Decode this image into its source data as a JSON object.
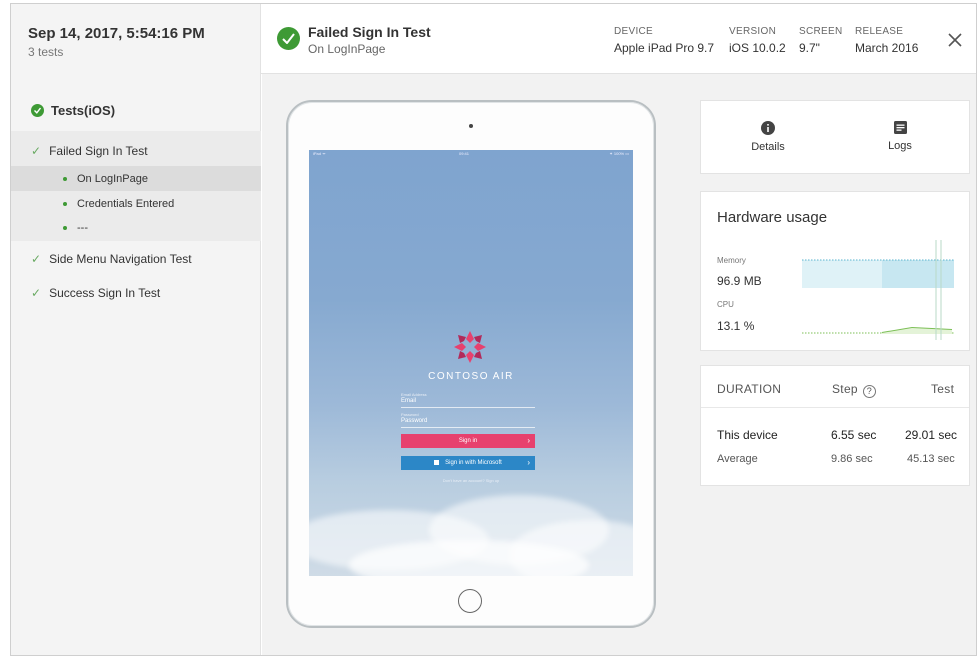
{
  "run": {
    "date": "Sep 14, 2017, 5:54:16 PM",
    "count": "3 tests"
  },
  "header": {
    "title": "Failed Sign In Test",
    "subtitle": "On LogInPage",
    "device_label": "DEVICE",
    "device_value": "Apple iPad Pro 9.7",
    "version_label": "VERSION",
    "version_value": "iOS 10.0.2",
    "screen_label": "SCREEN",
    "screen_value": "9.7\"",
    "release_label": "RELEASE",
    "release_value": "March 2016",
    "status_color": "#3e9a35"
  },
  "sidebar": {
    "root": "Tests(iOS)",
    "tests": [
      {
        "label": "Failed Sign In Test",
        "steps": [
          "On LogInPage",
          "Credentials Entered",
          "---"
        ]
      },
      {
        "label": "Side Menu Navigation Test"
      },
      {
        "label": "Success Sign In Test"
      }
    ]
  },
  "device_screen": {
    "status_left": "iPad ᯤ",
    "status_center": "09:41",
    "status_right": "✦ 100% ▭",
    "brand": "CONTOSO AIR",
    "email_label": "Email Address",
    "email_placeholder": "Email",
    "password_label": "Password",
    "password_placeholder": "Password",
    "signin": "Sign in",
    "signin_ms": "Sign in with Microsoft",
    "no_account": "Don't have an account? Sign up"
  },
  "tabs": {
    "details": "Details",
    "logs": "Logs"
  },
  "hardware": {
    "title": "Hardware usage",
    "memory_label": "Memory",
    "memory_value": "96.9 MB",
    "cpu_label": "CPU",
    "cpu_value": "13.1 %"
  },
  "duration": {
    "header": "DURATION",
    "step_label": "Step",
    "test_label": "Test",
    "help_glyph": "?",
    "rows": [
      {
        "label": "This device",
        "step": "6.55 sec",
        "test": "29.01 sec"
      },
      {
        "label": "Average",
        "step": "9.86 sec",
        "test": "45.13 sec"
      }
    ]
  }
}
